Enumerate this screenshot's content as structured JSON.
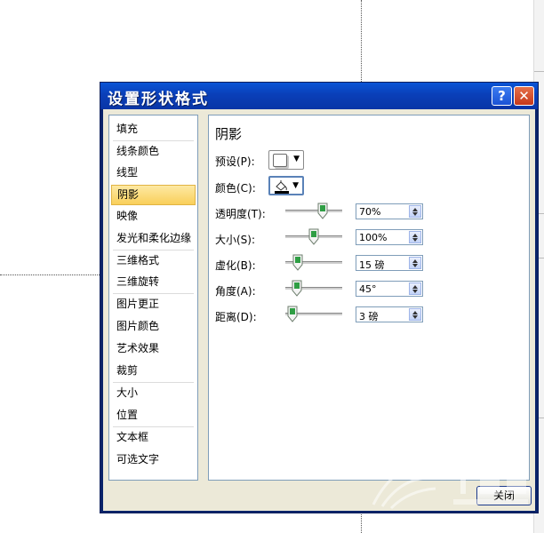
{
  "dialog": {
    "title": "设置形状格式",
    "help_label": "?",
    "close_label": "✕",
    "close_button_label": "关闭"
  },
  "nav": {
    "items": [
      {
        "label": "填充"
      },
      {
        "label": "线条颜色"
      },
      {
        "label": "线型"
      },
      {
        "label": "阴影",
        "selected": true
      },
      {
        "label": "映像"
      },
      {
        "label": "发光和柔化边缘"
      },
      {
        "label": "三维格式"
      },
      {
        "label": "三维旋转"
      },
      {
        "label": "图片更正"
      },
      {
        "label": "图片颜色"
      },
      {
        "label": "艺术效果"
      },
      {
        "label": "裁剪"
      },
      {
        "label": "大小"
      },
      {
        "label": "位置"
      },
      {
        "label": "文本框"
      },
      {
        "label": "可选文字"
      }
    ]
  },
  "shadow": {
    "section_title": "阴影",
    "preset_label": "预设(P):",
    "color_label": "颜色(C):",
    "transparency": {
      "label": "透明度(T):",
      "value": "70%",
      "slider_level": 0.7
    },
    "size": {
      "label": "大小(S):",
      "value": "100%",
      "slider_level": 0.5
    },
    "blur": {
      "label": "虚化(B):",
      "value": "15 磅",
      "slider_level": 0.15
    },
    "angle": {
      "label": "角度(A):",
      "value": "45°",
      "slider_level": 0.125
    },
    "distance": {
      "label": "距离(D):",
      "value": "3 磅",
      "slider_level": 0.03
    }
  },
  "colors": {
    "title_bar": "#0a46c8",
    "selected_item": "#f9cf5a",
    "slider_thumb": "#2f9e44"
  }
}
